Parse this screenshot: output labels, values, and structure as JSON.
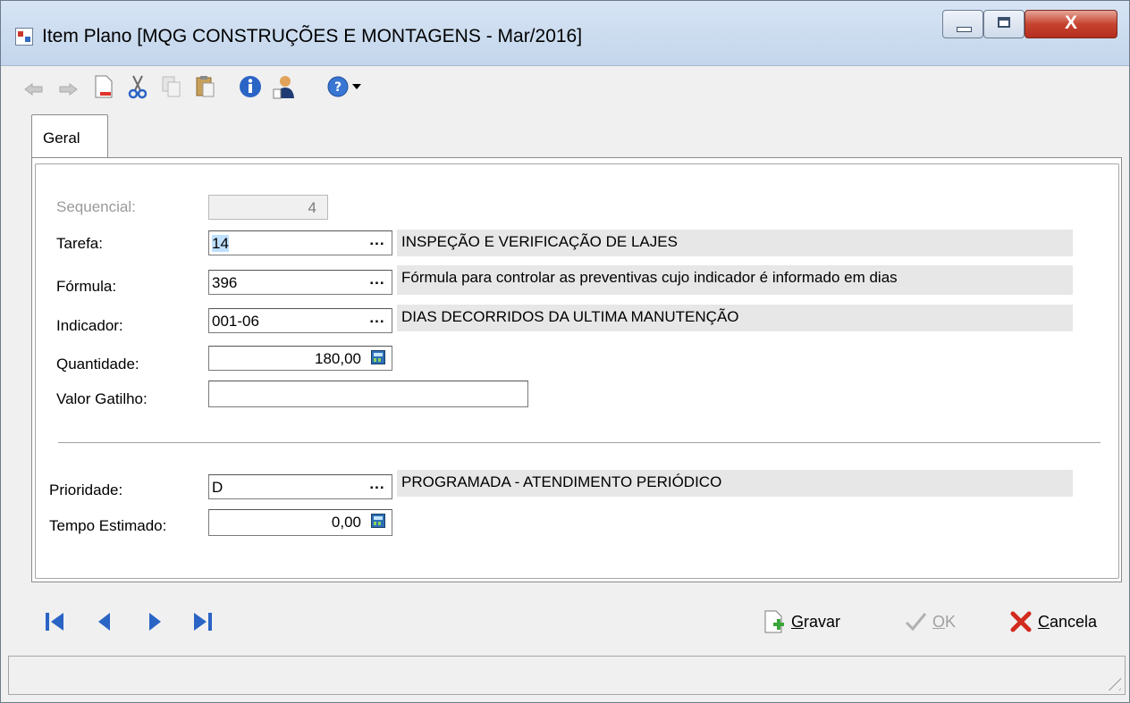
{
  "window": {
    "title": "Item Plano [MQG CONSTRUÇÕES E MONTAGENS - Mar/2016]",
    "close_glyph": "X"
  },
  "toolbar": {
    "items": [
      "undo-icon",
      "redo-icon",
      "new-document-icon",
      "cut-icon",
      "copy-icon",
      "paste-icon",
      "info-icon",
      "user-icon",
      "help-icon",
      "dropdown-arrow-icon"
    ]
  },
  "tabs": [
    {
      "label": "Geral",
      "selected": true
    }
  ],
  "form": {
    "sequencial": {
      "label": "Sequencial:",
      "value": "4"
    },
    "tarefa": {
      "label": "Tarefa:",
      "value": "14",
      "desc": "INSPEÇÃO E VERIFICAÇÃO DE LAJES"
    },
    "formula": {
      "label": "Fórmula:",
      "value": "396",
      "desc": "Fórmula para controlar as preventivas cujo indicador é informado em dias"
    },
    "indicador": {
      "label": "Indicador:",
      "value": "001-06",
      "desc": "DIAS DECORRIDOS DA ULTIMA MANUTENÇÃO"
    },
    "quantidade": {
      "label": "Quantidade:",
      "value": "180,00"
    },
    "valor_gatilho": {
      "label": "Valor Gatilho:",
      "value": ""
    },
    "prioridade": {
      "label": "Prioridade:",
      "value": "D",
      "desc": "PROGRAMADA - ATENDIMENTO PERIÓDICO"
    },
    "tempo_estimado": {
      "label": "Tempo Estimado:",
      "value": "0,00"
    },
    "ellipsis": "..."
  },
  "footer": {
    "gravar": {
      "underline": "G",
      "rest": "ravar"
    },
    "ok": {
      "underline": "O",
      "rest": "K"
    },
    "cancela": {
      "underline": "C",
      "rest": "ancela"
    }
  },
  "colors": {
    "selection": "#bfe0ff",
    "close_red": "#c6432f",
    "nav_blue": "#2a64c5"
  }
}
